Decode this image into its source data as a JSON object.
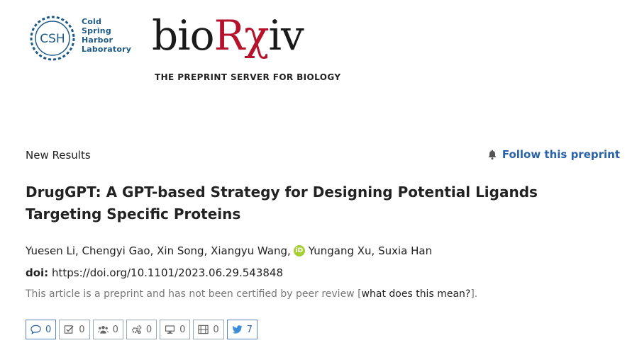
{
  "logos": {
    "csh_mark": "CSH",
    "csh_lines": [
      "Cold",
      "Spring",
      "Harbor",
      "Laboratory"
    ],
    "biorxiv_word_pre": "bio",
    "biorxiv_word_rx": "Rχ",
    "biorxiv_word_post": "iv",
    "biorxiv_tagline": "THE PREPRINT SERVER FOR BIOLOGY"
  },
  "article": {
    "category": "New Results",
    "follow_label": "Follow this preprint",
    "title": "DrugGPT: A GPT-based Strategy for Designing Potential Ligands Targeting Specific Proteins",
    "authors_before_orcid": "Yuesen Li, Chengyi Gao, Xin Song, Xiangyu Wang,",
    "orcid_label": "iD",
    "authors_after_orcid": "Yungang Xu, Suxia Han",
    "doi_label": "doi:",
    "doi_url": "https://doi.org/10.1101/2023.06.29.543848",
    "disclaimer_text": "This article is a preprint and has not been certified by peer review [",
    "disclaimer_link": "what does this mean?",
    "disclaimer_end": "]."
  },
  "metrics": [
    {
      "icon": "comment-icon",
      "value": "0"
    },
    {
      "icon": "checkbox-icon",
      "value": "0"
    },
    {
      "icon": "users-icon",
      "value": "0"
    },
    {
      "icon": "gears-icon",
      "value": "0"
    },
    {
      "icon": "monitor-icon",
      "value": "0"
    },
    {
      "icon": "film-icon",
      "value": "0"
    },
    {
      "icon": "twitter-icon",
      "value": "7"
    }
  ],
  "colors": {
    "link_blue": "#2a62a8",
    "biorxiv_red": "#b5122b",
    "csh_blue": "#1d5a86",
    "orcid_green": "#a6ce39"
  }
}
